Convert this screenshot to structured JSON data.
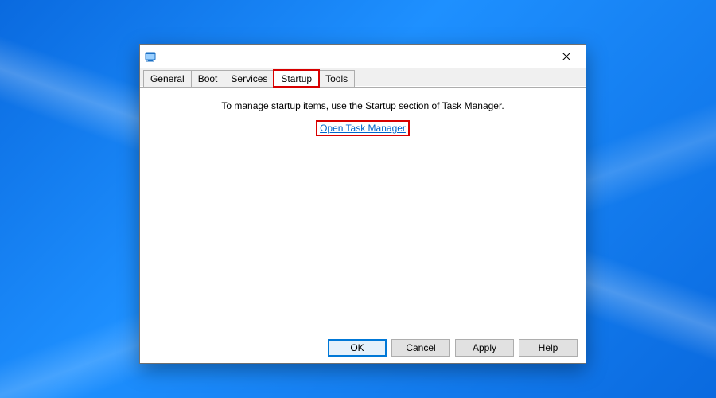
{
  "tabs": {
    "general": "General",
    "boot": "Boot",
    "services": "Services",
    "startup": "Startup",
    "tools": "Tools",
    "active": "startup"
  },
  "panel": {
    "instruction": "To manage startup items, use the Startup section of Task Manager.",
    "open_link": "Open Task Manager"
  },
  "buttons": {
    "ok": "OK",
    "cancel": "Cancel",
    "apply": "Apply",
    "help": "Help"
  }
}
